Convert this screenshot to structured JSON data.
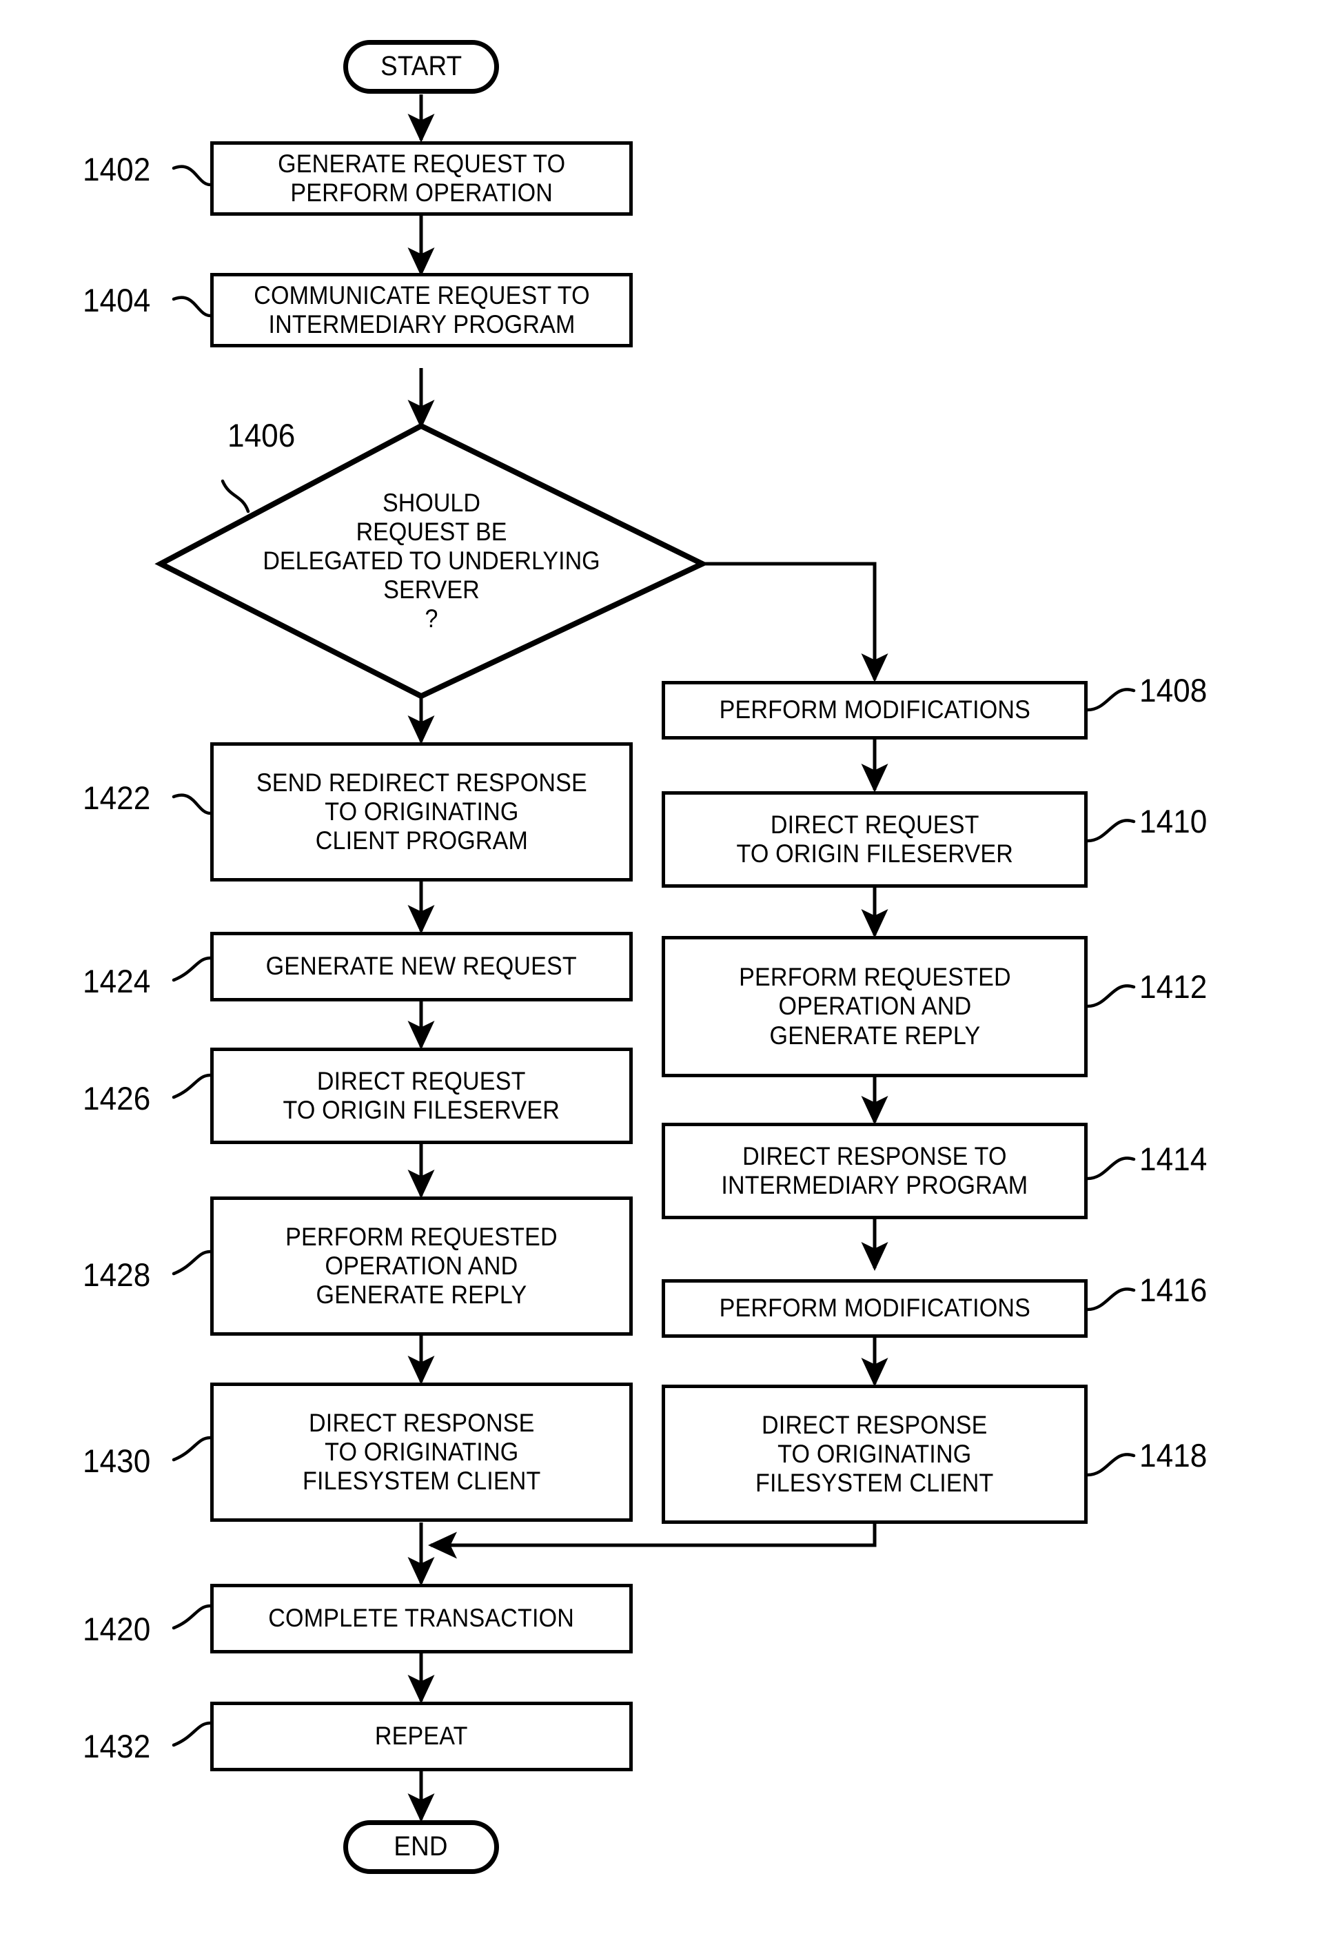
{
  "figure": {
    "type": "flowchart",
    "orientation": "two-branch vertical flow with decision diamond",
    "background_color": "#ffffff",
    "line_color": "#000000"
  },
  "nodes": {
    "start": {
      "label": "START",
      "shape": "terminator"
    },
    "end": {
      "label": "END",
      "shape": "terminator"
    },
    "n1402": {
      "ref": "1402",
      "label": "GENERATE REQUEST TO\nPERFORM OPERATION",
      "shape": "process"
    },
    "n1404": {
      "ref": "1404",
      "label": "COMMUNICATE REQUEST TO\nINTERMEDIARY PROGRAM",
      "shape": "process"
    },
    "n1406": {
      "ref": "1406",
      "label": "SHOULD\nREQUEST BE\nDELEGATED TO UNDERLYING\nSERVER\n?",
      "shape": "decision"
    },
    "n1408": {
      "ref": "1408",
      "label": "PERFORM MODIFICATIONS",
      "shape": "process"
    },
    "n1410": {
      "ref": "1410",
      "label": "DIRECT REQUEST\nTO ORIGIN FILESERVER",
      "shape": "process"
    },
    "n1412": {
      "ref": "1412",
      "label": "PERFORM REQUESTED\nOPERATION AND\nGENERATE REPLY",
      "shape": "process"
    },
    "n1414": {
      "ref": "1414",
      "label": "DIRECT RESPONSE TO\nINTERMEDIARY PROGRAM",
      "shape": "process"
    },
    "n1416": {
      "ref": "1416",
      "label": "PERFORM MODIFICATIONS",
      "shape": "process"
    },
    "n1418": {
      "ref": "1418",
      "label": "DIRECT RESPONSE\nTO ORIGINATING\nFILESYSTEM CLIENT",
      "shape": "process"
    },
    "n1422": {
      "ref": "1422",
      "label": "SEND REDIRECT RESPONSE\nTO ORIGINATING\nCLIENT PROGRAM",
      "shape": "process"
    },
    "n1424": {
      "ref": "1424",
      "label": "GENERATE NEW REQUEST",
      "shape": "process"
    },
    "n1426": {
      "ref": "1426",
      "label": "DIRECT REQUEST\nTO ORIGIN FILESERVER",
      "shape": "process"
    },
    "n1428": {
      "ref": "1428",
      "label": "PERFORM REQUESTED\nOPERATION AND\nGENERATE REPLY",
      "shape": "process"
    },
    "n1430": {
      "ref": "1430",
      "label": "DIRECT RESPONSE\nTO ORIGINATING\nFILESYSTEM CLIENT",
      "shape": "process"
    },
    "n1420": {
      "ref": "1420",
      "label": "COMPLETE TRANSACTION",
      "shape": "process"
    },
    "n1432": {
      "ref": "1432",
      "label": "REPEAT",
      "shape": "process"
    }
  },
  "edges": [
    {
      "from": "start",
      "to": "n1402"
    },
    {
      "from": "n1402",
      "to": "n1404"
    },
    {
      "from": "n1404",
      "to": "n1406"
    },
    {
      "from": "n1406",
      "to": "n1422",
      "branch": "no / down"
    },
    {
      "from": "n1406",
      "to": "n1408",
      "branch": "yes / right"
    },
    {
      "from": "n1408",
      "to": "n1410"
    },
    {
      "from": "n1410",
      "to": "n1412"
    },
    {
      "from": "n1412",
      "to": "n1414"
    },
    {
      "from": "n1414",
      "to": "n1416"
    },
    {
      "from": "n1416",
      "to": "n1418"
    },
    {
      "from": "n1418",
      "to": "n1420",
      "branch": "merge left"
    },
    {
      "from": "n1422",
      "to": "n1424"
    },
    {
      "from": "n1424",
      "to": "n1426"
    },
    {
      "from": "n1426",
      "to": "n1428"
    },
    {
      "from": "n1428",
      "to": "n1430"
    },
    {
      "from": "n1430",
      "to": "n1420"
    },
    {
      "from": "n1420",
      "to": "n1432"
    },
    {
      "from": "n1432",
      "to": "end"
    }
  ]
}
